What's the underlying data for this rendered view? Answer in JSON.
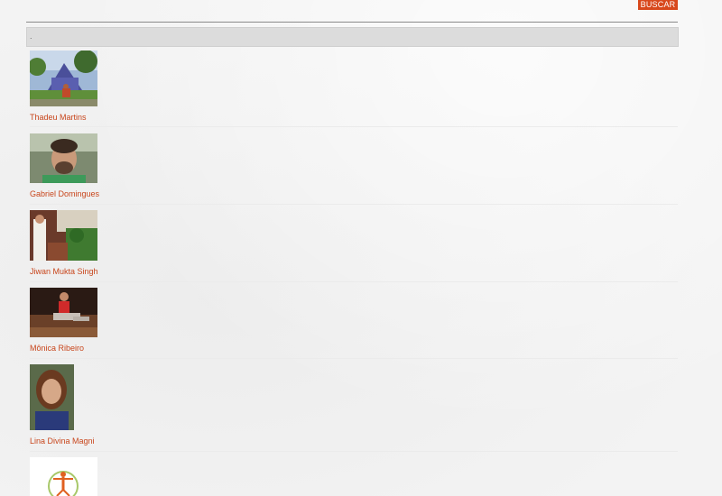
{
  "header": {
    "search_label": "BUSCAR"
  },
  "section": {
    "title": "."
  },
  "members": [
    {
      "name": "Thadeu Martins"
    },
    {
      "name": "Gabriel Domingues"
    },
    {
      "name": "Jiwan Mukta Singh"
    },
    {
      "name": "Mônica Ribeiro"
    },
    {
      "name": "Lina Divina Magni"
    }
  ],
  "colors": {
    "accent": "#d8481c",
    "link": "#c8461c",
    "bar": "#dcdcdc"
  }
}
